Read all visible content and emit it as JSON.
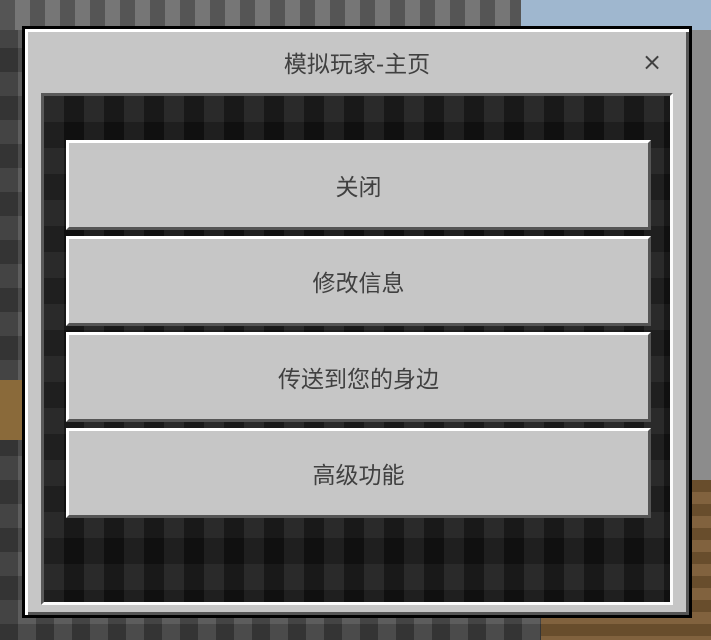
{
  "dialog": {
    "title": "模拟玩家-主页",
    "close_glyph": "×"
  },
  "buttons": [
    {
      "label": "关闭"
    },
    {
      "label": "修改信息"
    },
    {
      "label": "传送到您的身边"
    },
    {
      "label": "高级功能"
    }
  ],
  "colors": {
    "panel": "#c6c6c6",
    "text": "#404040",
    "content_bg": "#161616",
    "bevel_light": "#ffffff",
    "bevel_dark": "#555555"
  }
}
